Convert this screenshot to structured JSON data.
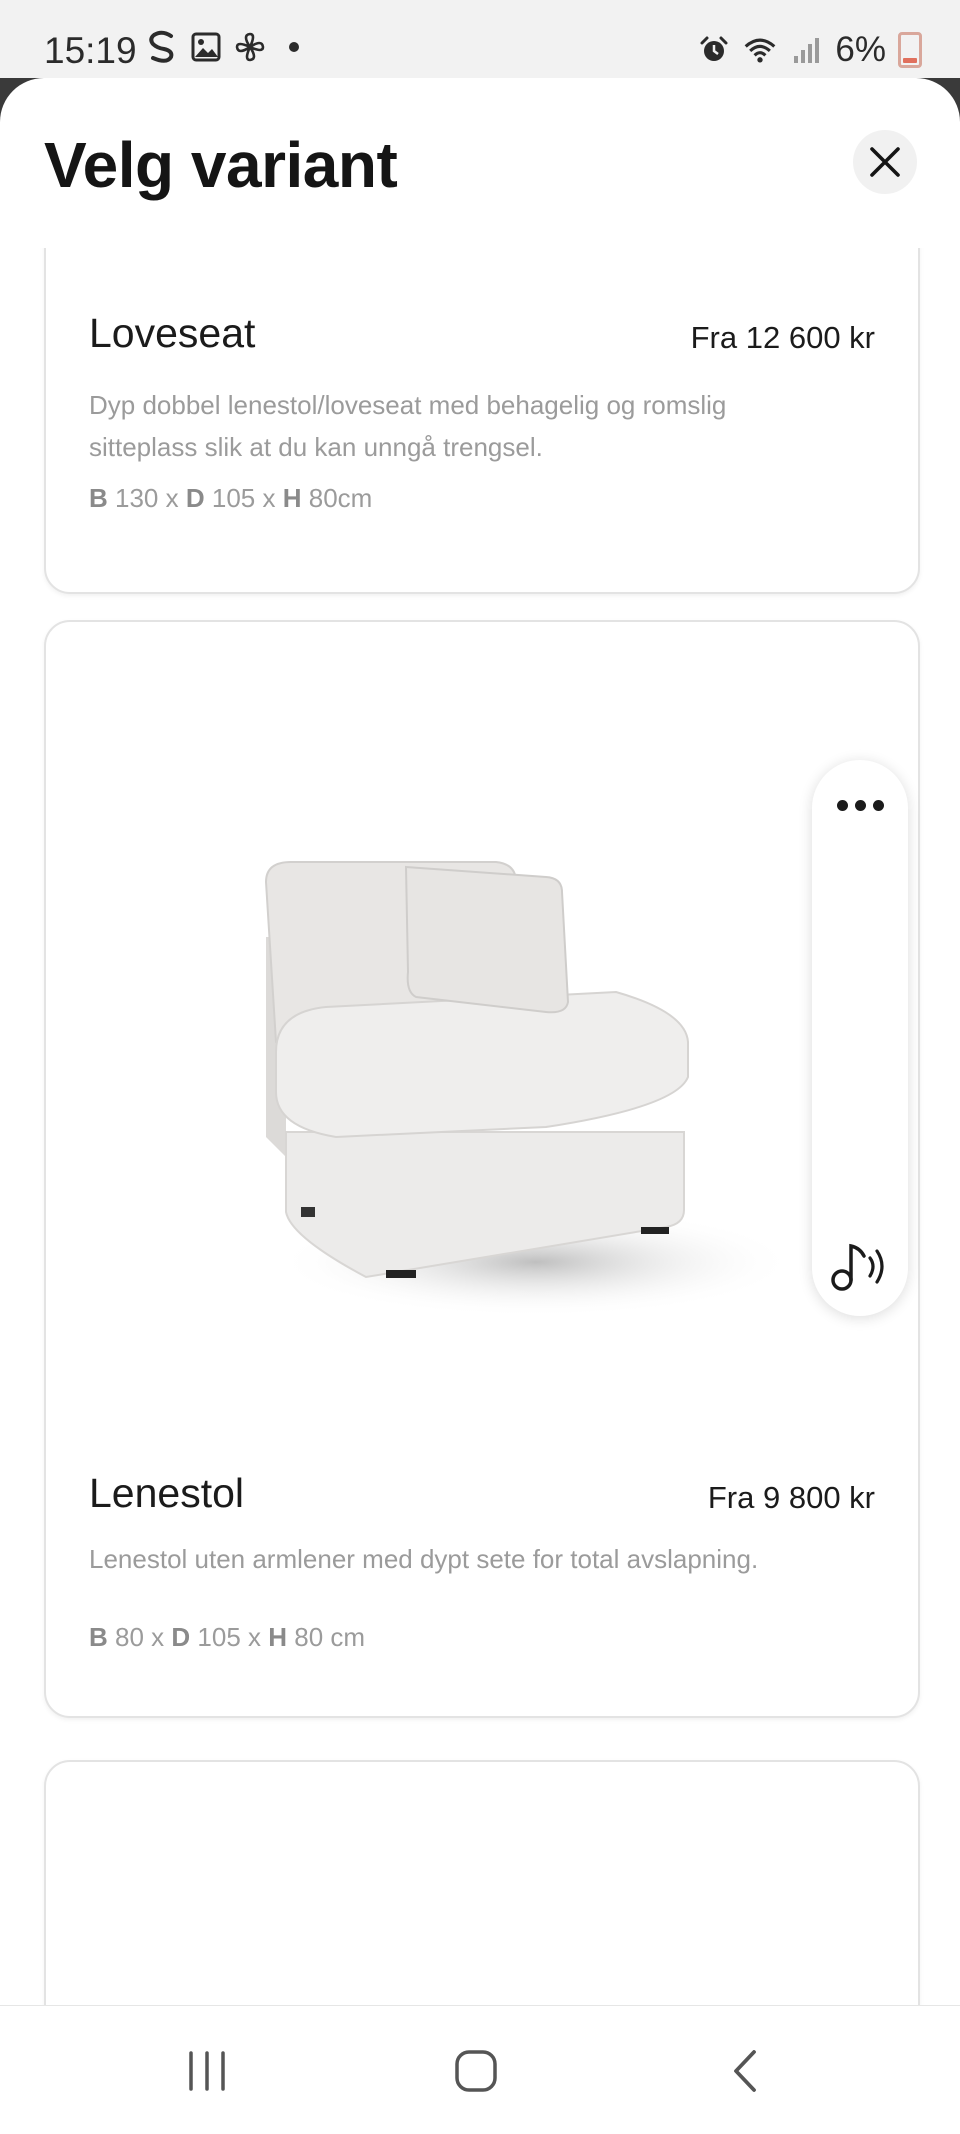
{
  "status_bar": {
    "time": "15:19",
    "left_icons": [
      "s-app-icon",
      "gallery-icon",
      "pinwheel-icon",
      "notification-dot-icon"
    ],
    "right_icons": [
      "alarm-icon",
      "wifi-icon",
      "signal-icon"
    ],
    "battery_text": "6%",
    "battery_color": "#e0705d"
  },
  "sheet": {
    "title": "Velg variant",
    "close_icon": "close-icon"
  },
  "variants": [
    {
      "name": "Loveseat",
      "price": "Fra 12 600 kr",
      "description": "Dyp dobbel lenestol/loveseat med behagelig og romslig sitteplass slik at du kan unngå trengsel.",
      "dims": {
        "b_label": "B",
        "b_value": "130 x",
        "d_label": "D",
        "d_value": "105 x",
        "h_label": "H",
        "h_value": "80cm"
      }
    },
    {
      "name": "Lenestol",
      "price": "Fra 9 800 kr",
      "description": "Lenestol uten armlener med dypt sete for total avslapning.",
      "image": "armless-chair-image",
      "dims": {
        "b_label": "B",
        "b_value": "80 x",
        "d_label": "D",
        "d_value": "105 x",
        "h_label": "H",
        "h_value": "80 cm"
      }
    }
  ],
  "floating_panel": {
    "menu_icon": "more-dots-icon",
    "audio_icon": "sound-reader-icon"
  },
  "nav_bar": {
    "icons": [
      "recent-apps-icon",
      "home-icon",
      "back-icon"
    ]
  }
}
